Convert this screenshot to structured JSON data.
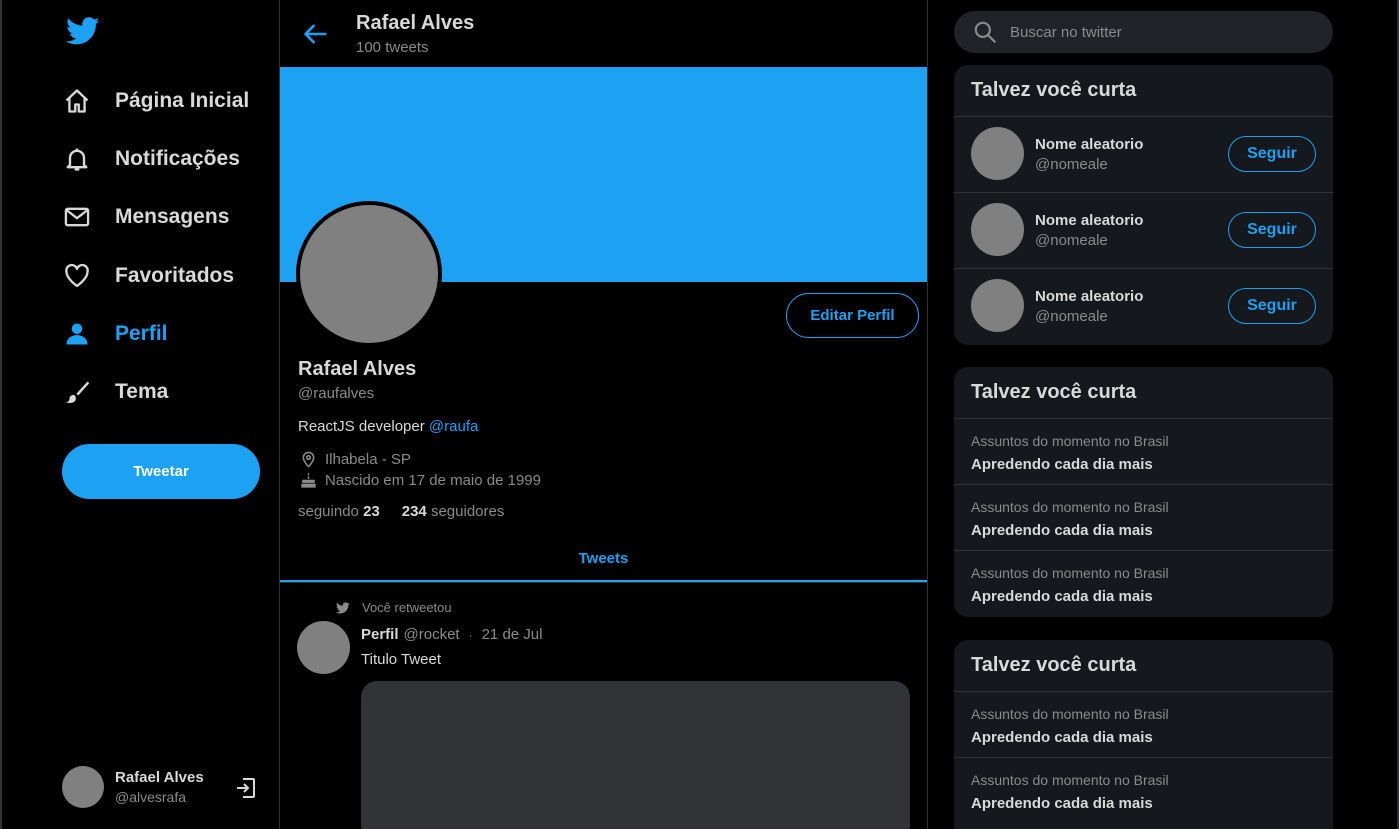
{
  "nav": {
    "items": [
      {
        "label": "Página Inicial",
        "icon": "home-icon"
      },
      {
        "label": "Notificações",
        "icon": "bell-icon"
      },
      {
        "label": "Mensagens",
        "icon": "mail-icon"
      },
      {
        "label": "Favoritados",
        "icon": "heart-icon"
      },
      {
        "label": "Perfil",
        "icon": "user-icon"
      },
      {
        "label": "Tema",
        "icon": "brush-icon"
      }
    ],
    "tweet_button": "Tweetar",
    "user": {
      "name": "Rafael Alves",
      "handle": "@alvesrafa"
    }
  },
  "header": {
    "name": "Rafael Alves",
    "tweet_count": "100 tweets"
  },
  "profile": {
    "edit_button": "Editar Perfil",
    "name": "Rafael Alves",
    "handle": "@raufalves",
    "bio_text": "ReactJS developer",
    "bio_mention": "@raufa",
    "location": "Ilhabela - SP",
    "born": "Nascido em 17 de maio de 1999",
    "following_label": "seguindo",
    "following_count": "23",
    "followers_count": "234",
    "followers_label": "seguidores",
    "tab": "Tweets"
  },
  "tweet": {
    "retweet_label": "Você retweetou",
    "author": "Perfil",
    "handle": "@rocket",
    "separator": "·",
    "date": "21 de Jul",
    "text": "Titulo Tweet"
  },
  "search": {
    "placeholder": "Buscar no twitter"
  },
  "suggestions": {
    "title": "Talvez você curta",
    "items": [
      {
        "name": "Nome aleatorio",
        "handle": "@nomeale",
        "button": "Seguir"
      },
      {
        "name": "Nome aleatorio",
        "handle": "@nomeale",
        "button": "Seguir"
      },
      {
        "name": "Nome aleatorio",
        "handle": "@nomeale",
        "button": "Seguir"
      }
    ]
  },
  "trends1": {
    "title": "Talvez você curta",
    "items": [
      {
        "context": "Assuntos do momento no Brasil",
        "topic": "Apredendo cada dia mais"
      },
      {
        "context": "Assuntos do momento no Brasil",
        "topic": "Apredendo cada dia mais"
      },
      {
        "context": "Assuntos do momento no Brasil",
        "topic": "Apredendo cada dia mais"
      }
    ]
  },
  "trends2": {
    "title": "Talvez você curta",
    "items": [
      {
        "context": "Assuntos do momento no Brasil",
        "topic": "Apredendo cada dia mais"
      },
      {
        "context": "Assuntos do momento no Brasil",
        "topic": "Apredendo cada dia mais"
      }
    ]
  },
  "colors": {
    "accent": "#1da1f2",
    "background": "#000000",
    "card": "#15181c",
    "avatar": "#808080"
  }
}
